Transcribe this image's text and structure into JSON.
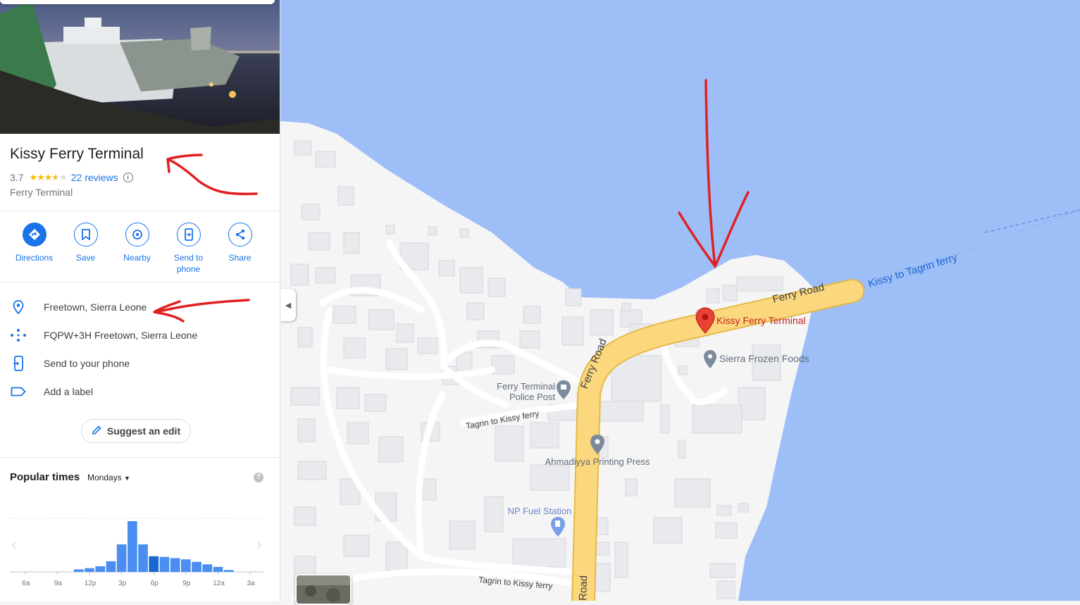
{
  "place": {
    "name": "Kissy Ferry Terminal",
    "rating": "3.7",
    "stars": 3.7,
    "reviews_label": "22 reviews",
    "category": "Ferry Terminal"
  },
  "actions": [
    {
      "label": "Directions",
      "icon": "directions-icon"
    },
    {
      "label": "Save",
      "icon": "bookmark-icon"
    },
    {
      "label": "Nearby",
      "icon": "nearby-icon"
    },
    {
      "label": "Send to phone",
      "icon": "send-to-phone-icon"
    },
    {
      "label": "Share",
      "icon": "share-icon"
    }
  ],
  "info_rows": {
    "address": "Freetown, Sierra Leone",
    "plus_code": "FQPW+3H Freetown, Sierra Leone",
    "send": "Send to your phone",
    "label": "Add a label"
  },
  "suggest_edit": "Suggest an edit",
  "popular_times": {
    "title": "Popular times",
    "day": "Mondays",
    "ticks": [
      "6a",
      "9a",
      "12p",
      "3p",
      "6p",
      "9p",
      "12a",
      "3a"
    ],
    "busyness": [
      0,
      0,
      0,
      0,
      0,
      4,
      6,
      9,
      17,
      44,
      81,
      44,
      25,
      24,
      22,
      20,
      16,
      12,
      8,
      3,
      0,
      0,
      0,
      0
    ],
    "current_hour_index": 12
  },
  "map": {
    "labels": {
      "terminal": "Kissy Ferry Terminal",
      "ferry_road_1": "Ferry Road",
      "ferry_road_2": "Ferry Road",
      "ferry_road_3": "Road",
      "ferry_route": "Kissy to Tagrin ferry",
      "sierra_frozen": "Sierra Frozen Foods",
      "police_1": "Ferry Terminal",
      "police_2": "Police Post",
      "tagrin_1": "Tagrin to Kissy ferry",
      "tagrin_2": "Tagrin to Kissy ferry",
      "ahmadiyya": "Ahmadiyya Printing Press",
      "fuel": "NP Fuel Station"
    },
    "colors": {
      "water": "#9ebef8",
      "land": "#f5f5f6",
      "road": "#fbd87d",
      "annotation": "#e02020"
    }
  }
}
